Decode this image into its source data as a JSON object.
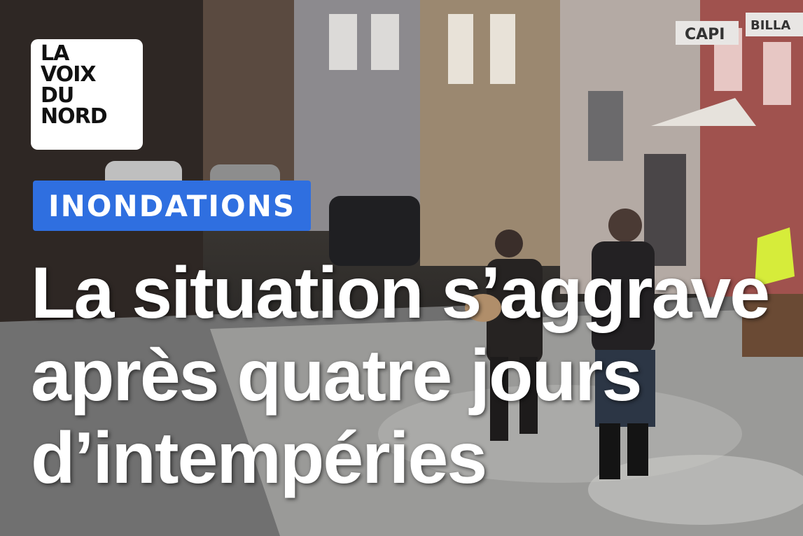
{
  "logo": {
    "lines": [
      "LA",
      "VOIX",
      "DU",
      "NORD"
    ]
  },
  "tag": {
    "label": "INONDATIONS",
    "color": "#2f6fe0"
  },
  "headline": {
    "lines": [
      "La situation s’aggrave",
      "après quatre jours",
      "d’intempéries"
    ]
  },
  "background": {
    "shop_sign": "CAPI",
    "shop_sign_2": "BILLA"
  }
}
